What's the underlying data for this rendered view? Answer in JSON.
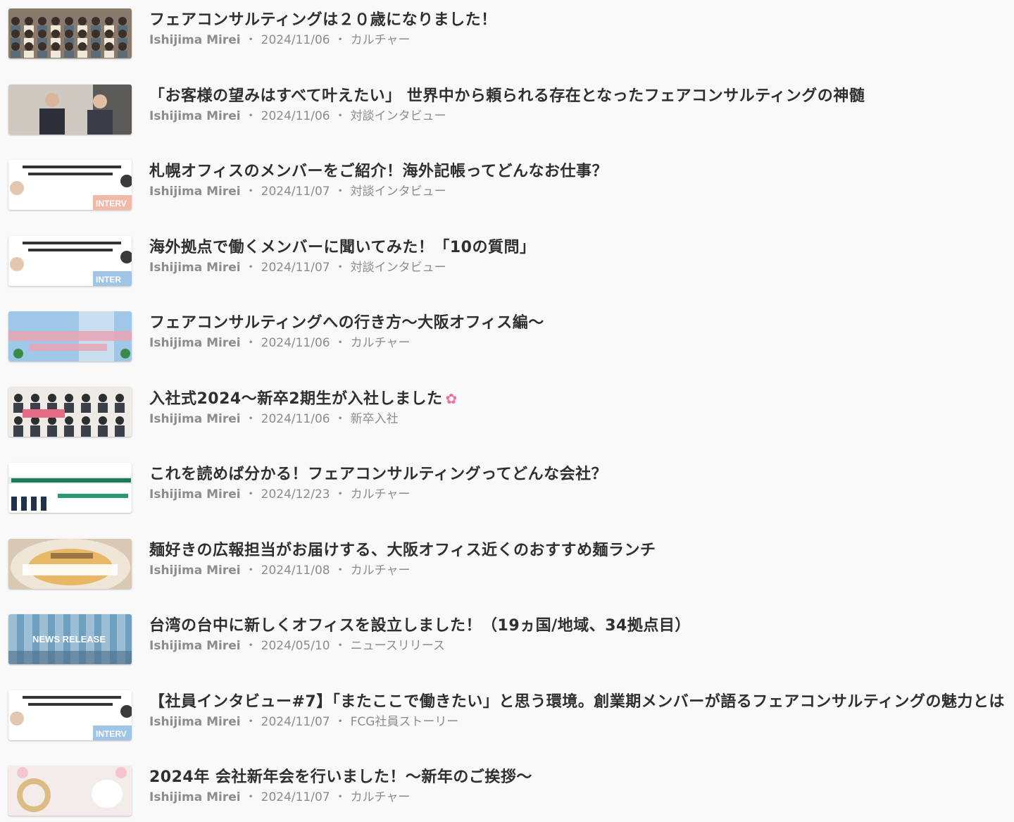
{
  "articles": [
    {
      "title": "フェアコンサルティングは２０歳になりました！",
      "author": "Ishijima Mirei",
      "date": "2024/11/06",
      "category": "カルチャー",
      "thumb": {
        "bg": "#8a7a6c",
        "accent": "#f1e8dc",
        "text": ""
      }
    },
    {
      "title": "「お客様の望みはすべて叶えたい」 世界中から頼られる存在となったフェアコンサルティングの神髄",
      "author": "Ishijima Mirei",
      "date": "2024/11/06",
      "category": "対談インタビュー",
      "thumb": {
        "bg": "#d7d3cd",
        "accent": "#2d3038",
        "text": ""
      }
    },
    {
      "title": "札幌オフィスのメンバーをご紹介！海外記帳ってどんなお仕事？",
      "author": "Ishijima Mirei",
      "date": "2024/11/07",
      "category": "対談インタビュー",
      "thumb": {
        "bg": "#ffffff",
        "accent": "#f2b8a8",
        "text": "INTERV"
      }
    },
    {
      "title": "海外拠点で働くメンバーに聞いてみた！「10の質問」",
      "author": "Ishijima Mirei",
      "date": "2024/11/07",
      "category": "対談インタビュー",
      "thumb": {
        "bg": "#ffffff",
        "accent": "#9fc4e6",
        "text": "INTER"
      }
    },
    {
      "title": "フェアコンサルティングへの行き方～大阪オフィス編～",
      "author": "Ishijima Mirei",
      "date": "2024/11/06",
      "category": "カルチャー",
      "thumb": {
        "bg": "#9fc8e8",
        "accent": "#e9a4b4",
        "text": ""
      }
    },
    {
      "title": "入社式2024～新卒2期生が入社しました",
      "author": "Ishijima Mirei",
      "date": "2024/11/06",
      "category": "新卒入社",
      "thumb": {
        "bg": "#eeeae6",
        "accent": "#e56b84",
        "text": ""
      }
    },
    {
      "title": "これを読めば分かる！フェアコンサルティングってどんな会社？",
      "author": "Ishijima Mirei",
      "date": "2024/12/23",
      "category": "カルチャー",
      "thumb": {
        "bg": "#ffffff",
        "accent": "#1f7a5a",
        "text": ""
      }
    },
    {
      "title": "麺好きの広報担当がお届けする、大阪オフィス近くのおすすめ麺ランチ",
      "author": "Ishijima Mirei",
      "date": "2024/11/08",
      "category": "カルチャー",
      "thumb": {
        "bg": "#d8c8b4",
        "accent": "#6a4a32",
        "text": ""
      }
    },
    {
      "title": "台湾の台中に新しくオフィスを設立しました！（19ヵ国/地域、34拠点目）",
      "author": "Ishijima Mirei",
      "date": "2024/05/10",
      "category": "ニュースリリース",
      "thumb": {
        "bg": "#6f9fbf",
        "accent": "#c9dfee",
        "text": "NEWS RELEASE"
      }
    },
    {
      "title": "【社員インタビュー#7】「またここで働きたい」と思う環境。創業期メンバーが語るフェアコンサルティングの魅力とは",
      "author": "Ishijima Mirei",
      "date": "2024/11/07",
      "category": "FCG社員ストーリー",
      "thumb": {
        "bg": "#ffffff",
        "accent": "#9fc4e6",
        "text": "INTERV"
      }
    },
    {
      "title": "2024年 会社新年会を行いました！～新年のご挨拶～",
      "author": "Ishijima Mirei",
      "date": "2024/11/07",
      "category": "カルチャー",
      "thumb": {
        "bg": "#f3ecea",
        "accent": "#d4b26a",
        "text": ""
      }
    }
  ]
}
